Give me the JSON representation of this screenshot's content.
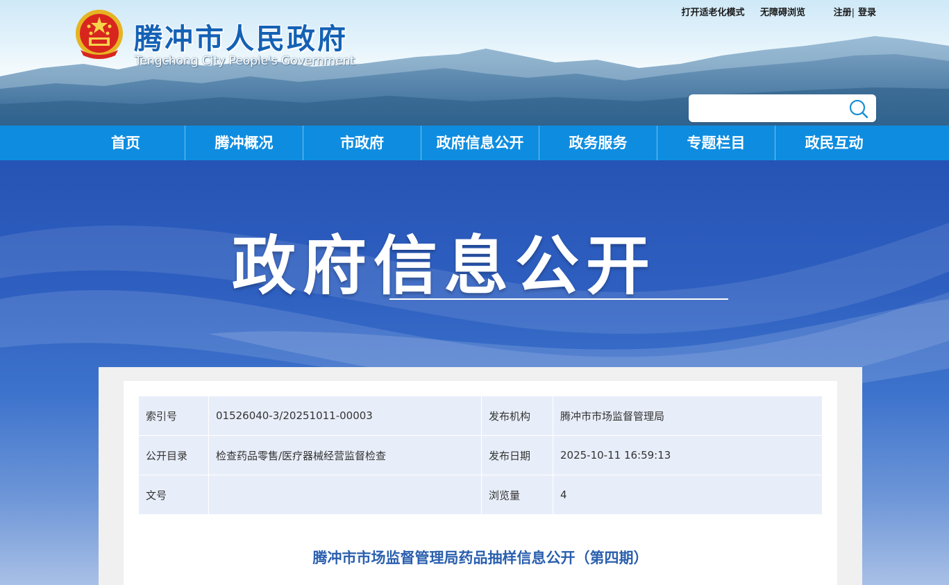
{
  "header": {
    "site_title": "腾冲市人民政府",
    "site_subtitle": "Tengchong City People's Government",
    "top_links": {
      "elderly_mode": "打开适老化模式",
      "accessible": "无障碍浏览",
      "register": "注册",
      "separator": "|",
      "login": "登录"
    },
    "search": {
      "placeholder": "",
      "icon": "search-icon"
    }
  },
  "nav": {
    "items": [
      {
        "label": "首页"
      },
      {
        "label": "腾冲概况"
      },
      {
        "label": "市政府"
      },
      {
        "label": "政府信息公开"
      },
      {
        "label": "政务服务"
      },
      {
        "label": "专题栏目"
      },
      {
        "label": "政民互动"
      }
    ]
  },
  "banner": {
    "title": "政府信息公开"
  },
  "info": {
    "rows": [
      {
        "k1": "索引号",
        "v1": "01526040-3/20251011-00003",
        "k2": "发布机构",
        "v2": "腾冲市市场监督管理局"
      },
      {
        "k1": "公开目录",
        "v1": "检查药品零售/医疗器械经营监督检查",
        "k2": "发布日期",
        "v2": "2025-10-11 16:59:13"
      },
      {
        "k1": "文号",
        "v1": "",
        "k2": "浏览量",
        "v2": "4"
      }
    ]
  },
  "article": {
    "title": "腾冲市市场监督管理局药品抽样信息公开（第四期）"
  },
  "colors": {
    "nav": "#0e8de0",
    "title_blue": "#1461b5",
    "article_title": "#2a5fae",
    "table_bg": "#e8eef9"
  }
}
